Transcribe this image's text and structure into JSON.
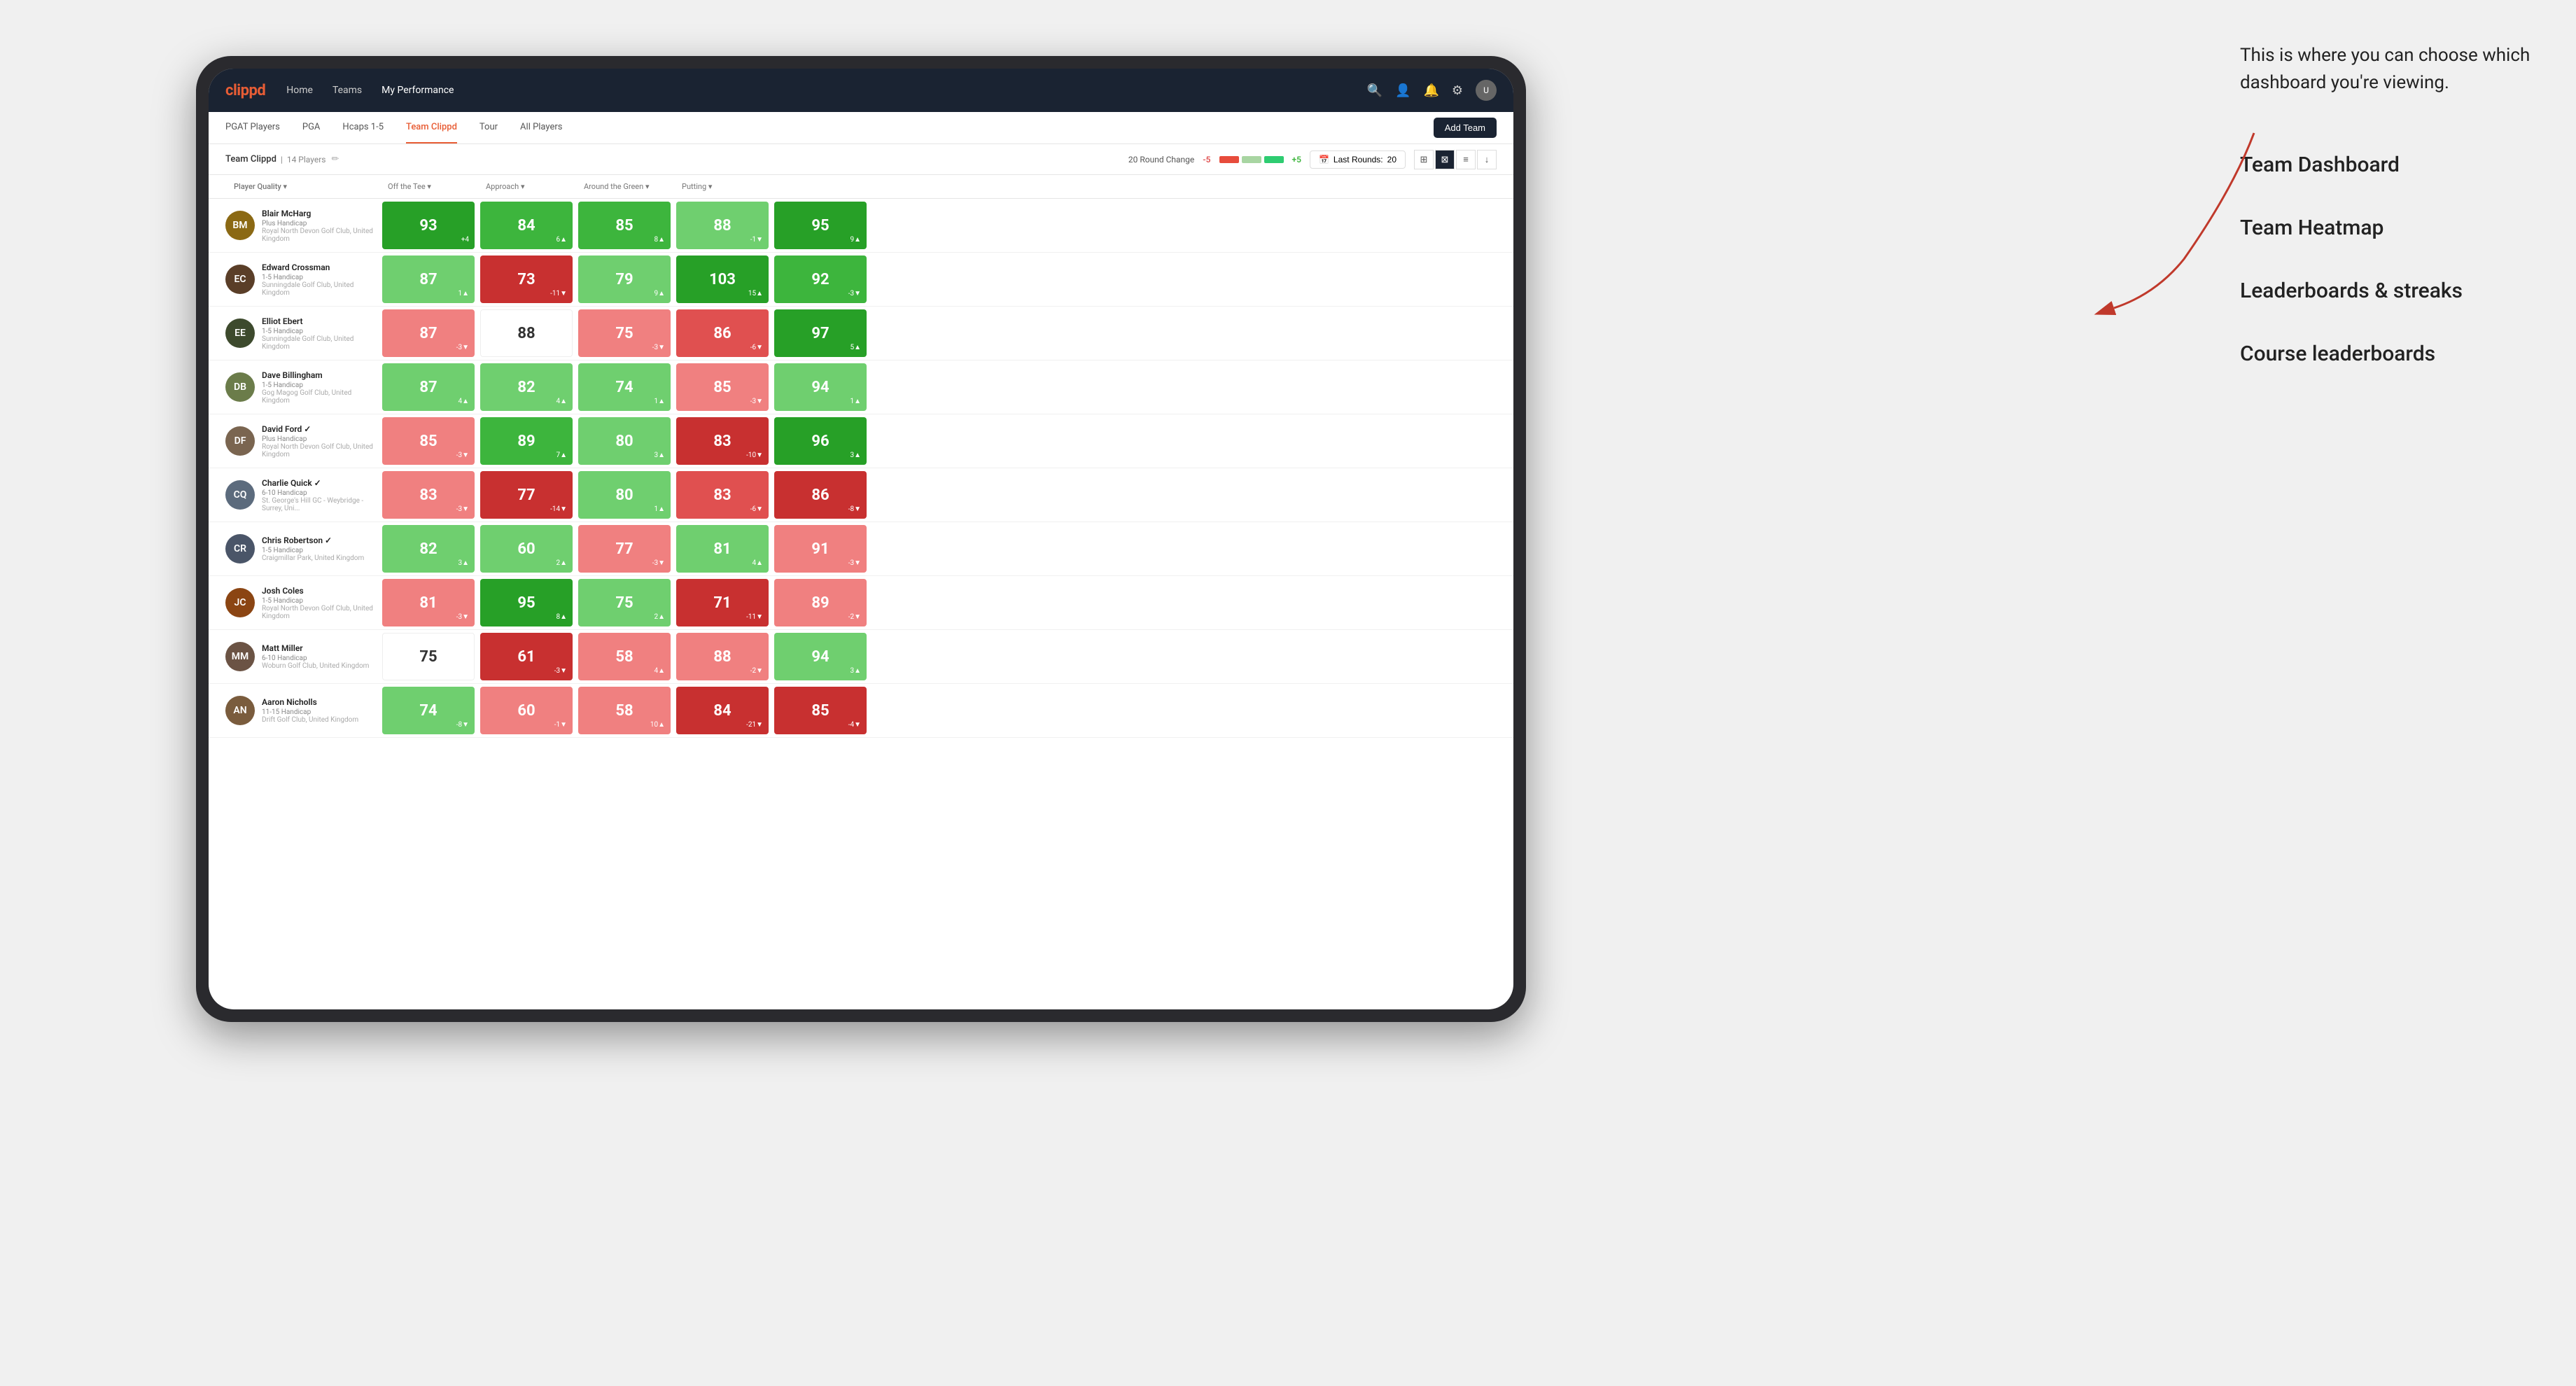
{
  "annotation": {
    "text": "This is where you can choose which dashboard you're viewing.",
    "options": [
      "Team Dashboard",
      "Team Heatmap",
      "Leaderboards & streaks",
      "Course leaderboards"
    ]
  },
  "navbar": {
    "logo": "clippd",
    "items": [
      {
        "label": "Home",
        "active": false
      },
      {
        "label": "Teams",
        "active": false
      },
      {
        "label": "My Performance",
        "active": true
      }
    ]
  },
  "subnav": {
    "items": [
      {
        "label": "PGAT Players"
      },
      {
        "label": "PGA"
      },
      {
        "label": "Hcaps 1-5"
      },
      {
        "label": "Team Clippd",
        "active": true
      },
      {
        "label": "Tour"
      },
      {
        "label": "All Players"
      }
    ],
    "add_team_label": "Add Team"
  },
  "team_header": {
    "name": "Team Clippd",
    "count": "14 Players",
    "round_change_label": "20 Round Change",
    "neg_value": "-5",
    "pos_value": "+5",
    "last_rounds_label": "Last Rounds:",
    "last_rounds_value": "20"
  },
  "table": {
    "columns": [
      {
        "label": "Player Quality ▾",
        "key": "player_quality"
      },
      {
        "label": "Off the Tee ▾",
        "key": "off_tee"
      },
      {
        "label": "Approach ▾",
        "key": "approach"
      },
      {
        "label": "Around the Green ▾",
        "key": "around_green"
      },
      {
        "label": "Putting ▾",
        "key": "putting"
      }
    ],
    "players": [
      {
        "name": "Blair McHarg",
        "handicap": "Plus Handicap",
        "club": "Royal North Devon Golf Club, United Kingdom",
        "initials": "BM",
        "avatar_color": "#8B6914",
        "scores": {
          "player_quality": {
            "value": 93,
            "change": "+4",
            "trend": "up",
            "color": "green-dark"
          },
          "off_tee": {
            "value": 84,
            "change": "6▲",
            "trend": "up",
            "color": "green-med"
          },
          "approach": {
            "value": 85,
            "change": "8▲",
            "trend": "up",
            "color": "green-med"
          },
          "around_green": {
            "value": 88,
            "change": "-1▼",
            "trend": "down",
            "color": "green-light"
          },
          "putting": {
            "value": 95,
            "change": "9▲",
            "trend": "up",
            "color": "green-dark"
          }
        }
      },
      {
        "name": "Edward Crossman",
        "handicap": "1-5 Handicap",
        "club": "Sunningdale Golf Club, United Kingdom",
        "initials": "EC",
        "avatar_color": "#5a3e28",
        "scores": {
          "player_quality": {
            "value": 87,
            "change": "1▲",
            "trend": "up",
            "color": "green-light"
          },
          "off_tee": {
            "value": 73,
            "change": "-11▼",
            "trend": "down",
            "color": "red-dark"
          },
          "approach": {
            "value": 79,
            "change": "9▲",
            "trend": "up",
            "color": "green-light"
          },
          "around_green": {
            "value": 103,
            "change": "15▲",
            "trend": "up",
            "color": "green-dark"
          },
          "putting": {
            "value": 92,
            "change": "-3▼",
            "trend": "down",
            "color": "green-med"
          }
        }
      },
      {
        "name": "Elliot Ebert",
        "handicap": "1-5 Handicap",
        "club": "Sunningdale Golf Club, United Kingdom",
        "initials": "EE",
        "avatar_color": "#3d4a2d",
        "scores": {
          "player_quality": {
            "value": 87,
            "change": "-3▼",
            "trend": "down",
            "color": "red-light"
          },
          "off_tee": {
            "value": 88,
            "change": "",
            "trend": "neutral",
            "color": "white"
          },
          "approach": {
            "value": 75,
            "change": "-3▼",
            "trend": "down",
            "color": "red-light"
          },
          "around_green": {
            "value": 86,
            "change": "-6▼",
            "trend": "down",
            "color": "red-med"
          },
          "putting": {
            "value": 97,
            "change": "5▲",
            "trend": "up",
            "color": "green-dark"
          }
        }
      },
      {
        "name": "Dave Billingham",
        "handicap": "1-5 Handicap",
        "club": "Gog Magog Golf Club, United Kingdom",
        "initials": "DB",
        "avatar_color": "#6b7c4a",
        "scores": {
          "player_quality": {
            "value": 87,
            "change": "4▲",
            "trend": "up",
            "color": "green-light"
          },
          "off_tee": {
            "value": 82,
            "change": "4▲",
            "trend": "up",
            "color": "green-light"
          },
          "approach": {
            "value": 74,
            "change": "1▲",
            "trend": "up",
            "color": "green-light"
          },
          "around_green": {
            "value": 85,
            "change": "-3▼",
            "trend": "down",
            "color": "red-light"
          },
          "putting": {
            "value": 94,
            "change": "1▲",
            "trend": "up",
            "color": "green-light"
          }
        }
      },
      {
        "name": "David Ford",
        "handicap": "Plus Handicap",
        "club": "Royal North Devon Golf Club, United Kingdom",
        "initials": "DF",
        "avatar_color": "#7a6550",
        "verified": true,
        "scores": {
          "player_quality": {
            "value": 85,
            "change": "-3▼",
            "trend": "down",
            "color": "red-light"
          },
          "off_tee": {
            "value": 89,
            "change": "7▲",
            "trend": "up",
            "color": "green-med"
          },
          "approach": {
            "value": 80,
            "change": "3▲",
            "trend": "up",
            "color": "green-light"
          },
          "around_green": {
            "value": 83,
            "change": "-10▼",
            "trend": "down",
            "color": "red-dark"
          },
          "putting": {
            "value": 96,
            "change": "3▲",
            "trend": "up",
            "color": "green-dark"
          }
        }
      },
      {
        "name": "Charlie Quick",
        "handicap": "6-10 Handicap",
        "club": "St. George's Hill GC - Weybridge - Surrey, Uni...",
        "initials": "CQ",
        "avatar_color": "#5c6b7d",
        "verified": true,
        "scores": {
          "player_quality": {
            "value": 83,
            "change": "-3▼",
            "trend": "down",
            "color": "red-light"
          },
          "off_tee": {
            "value": 77,
            "change": "-14▼",
            "trend": "down",
            "color": "red-dark"
          },
          "approach": {
            "value": 80,
            "change": "1▲",
            "trend": "up",
            "color": "green-light"
          },
          "around_green": {
            "value": 83,
            "change": "-6▼",
            "trend": "down",
            "color": "red-med"
          },
          "putting": {
            "value": 86,
            "change": "-8▼",
            "trend": "down",
            "color": "red-dark"
          }
        }
      },
      {
        "name": "Chris Robertson",
        "handicap": "1-5 Handicap",
        "club": "Craigmillar Park, United Kingdom",
        "initials": "CR",
        "avatar_color": "#4a5568",
        "verified": true,
        "scores": {
          "player_quality": {
            "value": 82,
            "change": "3▲",
            "trend": "up",
            "color": "green-light"
          },
          "off_tee": {
            "value": 60,
            "change": "2▲",
            "trend": "up",
            "color": "green-light"
          },
          "approach": {
            "value": 77,
            "change": "-3▼",
            "trend": "down",
            "color": "red-light"
          },
          "around_green": {
            "value": 81,
            "change": "4▲",
            "trend": "up",
            "color": "green-light"
          },
          "putting": {
            "value": 91,
            "change": "-3▼",
            "trend": "down",
            "color": "red-light"
          }
        }
      },
      {
        "name": "Josh Coles",
        "handicap": "1-5 Handicap",
        "club": "Royal North Devon Golf Club, United Kingdom",
        "initials": "JC",
        "avatar_color": "#8B4513",
        "scores": {
          "player_quality": {
            "value": 81,
            "change": "-3▼",
            "trend": "down",
            "color": "red-light"
          },
          "off_tee": {
            "value": 95,
            "change": "8▲",
            "trend": "up",
            "color": "green-dark"
          },
          "approach": {
            "value": 75,
            "change": "2▲",
            "trend": "up",
            "color": "green-light"
          },
          "around_green": {
            "value": 71,
            "change": "-11▼",
            "trend": "down",
            "color": "red-dark"
          },
          "putting": {
            "value": 89,
            "change": "-2▼",
            "trend": "down",
            "color": "red-light"
          }
        }
      },
      {
        "name": "Matt Miller",
        "handicap": "6-10 Handicap",
        "club": "Woburn Golf Club, United Kingdom",
        "initials": "MM",
        "avatar_color": "#6b5344",
        "scores": {
          "player_quality": {
            "value": 75,
            "change": "",
            "trend": "neutral",
            "color": "white"
          },
          "off_tee": {
            "value": 61,
            "change": "-3▼",
            "trend": "down",
            "color": "red-dark"
          },
          "approach": {
            "value": 58,
            "change": "4▲",
            "trend": "up",
            "color": "red-light"
          },
          "around_green": {
            "value": 88,
            "change": "-2▼",
            "trend": "down",
            "color": "red-light"
          },
          "putting": {
            "value": 94,
            "change": "3▲",
            "trend": "up",
            "color": "green-light"
          }
        }
      },
      {
        "name": "Aaron Nicholls",
        "handicap": "11-15 Handicap",
        "club": "Drift Golf Club, United Kingdom",
        "initials": "AN",
        "avatar_color": "#7a5c3d",
        "scores": {
          "player_quality": {
            "value": 74,
            "change": "-8▼",
            "trend": "down",
            "color": "green-light"
          },
          "off_tee": {
            "value": 60,
            "change": "-1▼",
            "trend": "down",
            "color": "red-light"
          },
          "approach": {
            "value": 58,
            "change": "10▲",
            "trend": "up",
            "color": "red-light"
          },
          "around_green": {
            "value": 84,
            "change": "-21▼",
            "trend": "down",
            "color": "red-dark"
          },
          "putting": {
            "value": 85,
            "change": "-4▼",
            "trend": "down",
            "color": "red-dark"
          }
        }
      }
    ]
  }
}
